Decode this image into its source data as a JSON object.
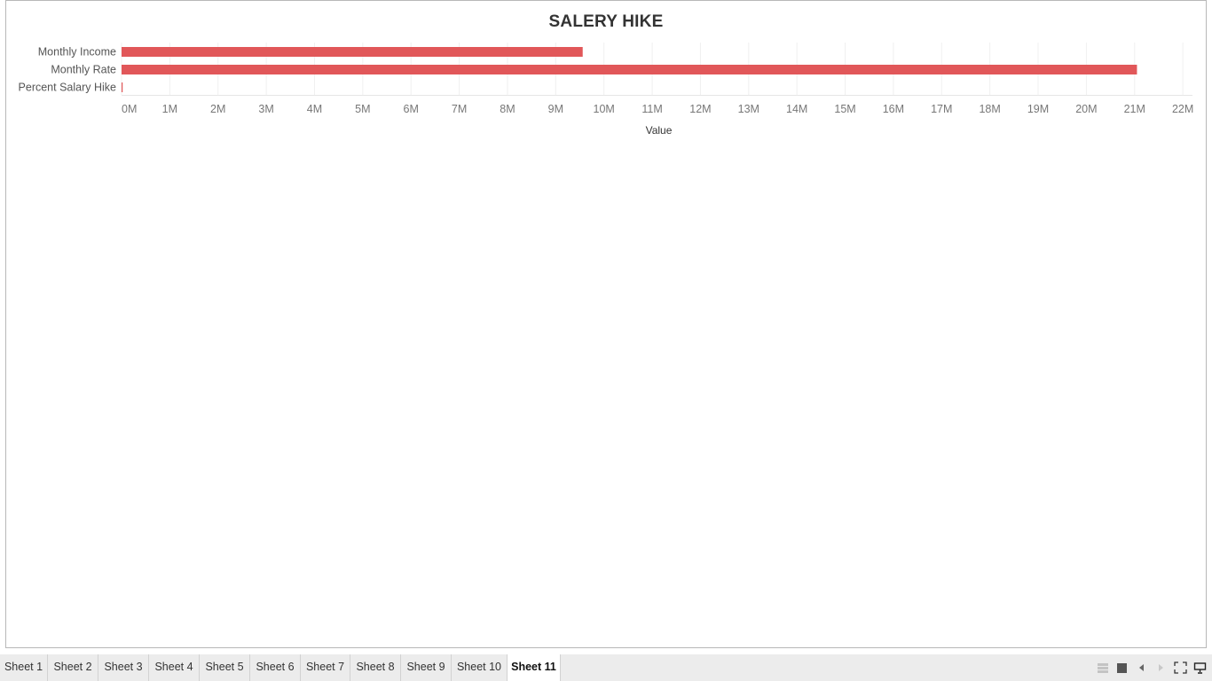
{
  "chart_data": {
    "type": "bar",
    "orientation": "horizontal",
    "title": "SALERY HIKE",
    "xlabel": "Value",
    "ylabel": "",
    "categories": [
      "Monthly Income",
      "Monthly Rate",
      "Percent Salary Hike"
    ],
    "values": [
      9559299,
      21049293,
      22409
    ],
    "xlim": [
      0,
      22200000
    ],
    "ticks": [
      0,
      1000000,
      2000000,
      3000000,
      4000000,
      5000000,
      6000000,
      7000000,
      8000000,
      9000000,
      10000000,
      11000000,
      12000000,
      13000000,
      14000000,
      15000000,
      16000000,
      17000000,
      18000000,
      19000000,
      20000000,
      21000000,
      22000000
    ],
    "tick_labels": [
      "0M",
      "1M",
      "2M",
      "3M",
      "4M",
      "5M",
      "6M",
      "7M",
      "8M",
      "9M",
      "10M",
      "11M",
      "12M",
      "13M",
      "14M",
      "15M",
      "16M",
      "17M",
      "18M",
      "19M",
      "20M",
      "21M",
      "22M"
    ],
    "grid": true,
    "bar_color": "#e15759"
  },
  "tabs": [
    {
      "label": "Sheet 1"
    },
    {
      "label": "Sheet 2"
    },
    {
      "label": "Sheet 3"
    },
    {
      "label": "Sheet 4"
    },
    {
      "label": "Sheet 5"
    },
    {
      "label": "Sheet 6"
    },
    {
      "label": "Sheet 7"
    },
    {
      "label": "Sheet 8"
    },
    {
      "label": "Sheet 9"
    },
    {
      "label": "Sheet 10"
    },
    {
      "label": "Sheet 11",
      "active": true
    }
  ],
  "controls": [
    {
      "name": "show-tabs-icon"
    },
    {
      "name": "filmstrip-icon"
    },
    {
      "name": "previous-sheet-icon"
    },
    {
      "name": "next-sheet-icon"
    },
    {
      "name": "fullscreen-icon"
    },
    {
      "name": "presentation-mode-icon"
    }
  ]
}
